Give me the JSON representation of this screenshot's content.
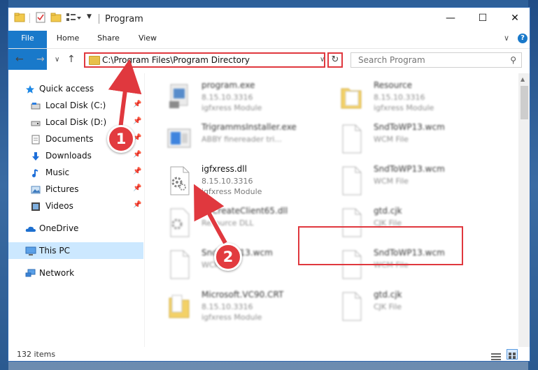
{
  "window": {
    "title": "Program",
    "controls": {
      "minimize": "—",
      "maximize": "☐",
      "close": "✕"
    }
  },
  "ribbon": {
    "tabs": [
      "File",
      "Home",
      "Share",
      "View"
    ],
    "help": "?",
    "expand": "∨"
  },
  "navigation": {
    "back": "←",
    "forward": "→",
    "recent": "∨",
    "up": "↑",
    "address": "C:\\Program Files\\Program Directory",
    "address_dropdown": "∨",
    "refresh": "↻",
    "search_placeholder": "Search Program",
    "search_icon": "⚲"
  },
  "sidebar": {
    "items": [
      {
        "label": "Quick access",
        "icon": "star-icon",
        "pinned": false
      },
      {
        "label": "Local Disk (C:)",
        "icon": "drive-icon",
        "pinned": true
      },
      {
        "label": "Local Disk (D:)",
        "icon": "drive-icon",
        "pinned": true
      },
      {
        "label": "Documents",
        "icon": "documents-icon",
        "pinned": true
      },
      {
        "label": "Downloads",
        "icon": "downloads-icon",
        "pinned": true
      },
      {
        "label": "Music",
        "icon": "music-icon",
        "pinned": true
      },
      {
        "label": "Pictures",
        "icon": "pictures-icon",
        "pinned": true
      },
      {
        "label": "Videos",
        "icon": "videos-icon",
        "pinned": true
      },
      {
        "label": "OneDrive",
        "icon": "onedrive-icon",
        "pinned": false
      },
      {
        "label": "This PC",
        "icon": "this-pc-icon",
        "pinned": false,
        "selected": true
      },
      {
        "label": "Network",
        "icon": "network-icon",
        "pinned": false
      }
    ],
    "pin_glyph": "📌"
  },
  "files": [
    {
      "name": "program.exe",
      "line2": "8.15.10.3316",
      "line3": "igfxress Module",
      "icon": "exe-icon",
      "blurred": true
    },
    {
      "name": "Resource",
      "line2": "8.15.10.3316",
      "line3": "igfxress Module",
      "icon": "folder-icon",
      "blurred": true
    },
    {
      "name": "TrigrammsInstaller.exe",
      "line2": "ABBY finereader tri...",
      "line3": "",
      "icon": "installer-icon",
      "blurred": true
    },
    {
      "name": "SndToWP13.wcm",
      "line2": "WCM File",
      "line3": "",
      "icon": "blank-file-icon",
      "blurred": true
    },
    {
      "name": "igfxress.dll",
      "line2": "8.15.10.3316",
      "line3": "igfxress Module",
      "icon": "dll-gear-icon",
      "blurred": false
    },
    {
      "name": "SndToWP13.wcm",
      "line2": "WCM File",
      "line3": "",
      "icon": "blank-file-icon",
      "blurred": true
    },
    {
      "name": "ReCreateClient65.dll",
      "line2": "Resource DLL",
      "line3": "",
      "icon": "dll-gear-icon",
      "blurred": true
    },
    {
      "name": "gtd.cjk",
      "line2": "CJK File",
      "line3": "",
      "icon": "blank-file-icon",
      "blurred": true
    },
    {
      "name": "SndToWP13.wcm",
      "line2": "WCM File",
      "line3": "",
      "icon": "blank-file-icon",
      "blurred": true
    },
    {
      "name": "SndToWP13.wcm",
      "line2": "WCM File",
      "line3": "",
      "icon": "blank-file-icon",
      "blurred": true
    },
    {
      "name": "Microsoft.VC90.CRT",
      "line2": "8.15.10.3316",
      "line3": "igfxress Module",
      "icon": "folder-doc-icon",
      "blurred": true
    },
    {
      "name": "gtd.cjk",
      "line2": "CJK File",
      "line3": "",
      "icon": "blank-file-icon",
      "blurred": true
    }
  ],
  "status": {
    "items": "132 items"
  },
  "annotations": {
    "badge1": "1",
    "badge2": "2"
  },
  "colors": {
    "accent": "#1979ca",
    "highlight": "#e0383e",
    "selection": "#cce8ff"
  }
}
